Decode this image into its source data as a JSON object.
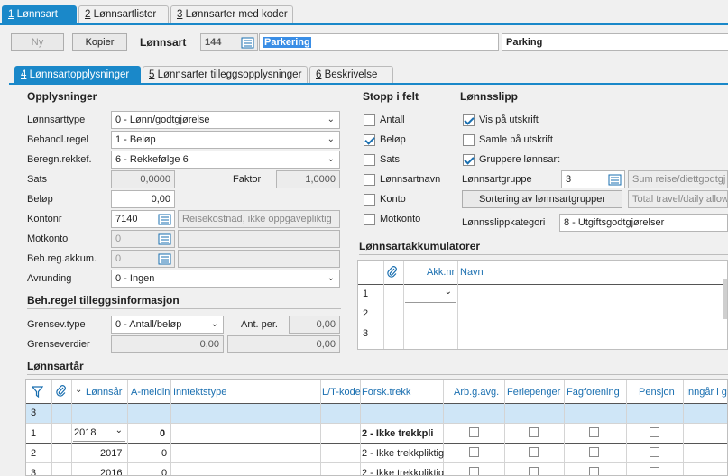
{
  "top_tabs": [
    {
      "num": "1",
      "label": " Lønnsart"
    },
    {
      "num": "2",
      "label": " Lønnsartlister"
    },
    {
      "num": "3",
      "label": " Lønnsarter med koder"
    }
  ],
  "toolbar": {
    "new_label": "Ny",
    "copy_label": "Kopier",
    "field_label": "Lønnsart",
    "code": "144",
    "name_value": "Parkering",
    "name2_value": "Parking"
  },
  "sub_tabs": [
    {
      "num": "4",
      "label": " Lønnsartopplysninger"
    },
    {
      "num": "5",
      "label": " Lønnsarter tilleggsopplysninger"
    },
    {
      "num": "6",
      "label": " Beskrivelse"
    }
  ],
  "opplysninger": {
    "title": "Opplysninger",
    "lonnsarttype_label": "Lønnsarttype",
    "lonnsarttype_value": "0 - Lønn/godtgjørelse",
    "behandl_label": "Behandl.regel",
    "behandl_value": "1 - Beløp",
    "beregn_label": "Beregn.rekkef.",
    "beregn_value": "6 - Rekkefølge 6",
    "sats_label": "Sats",
    "sats_value": "0,0000",
    "faktor_label": "Faktor",
    "faktor_value": "1,0000",
    "belop_label": "Beløp",
    "belop_value": "0,00",
    "kontonr_label": "Kontonr",
    "kontonr_value": "7140",
    "kontonr_desc": "Reisekostnad, ikke oppgavepliktig",
    "motkonto_label": "Motkonto",
    "motkonto_value": "0",
    "behreg_label": "Beh.reg.akkum.",
    "behreg_value": "0",
    "avrunding_label": "Avrunding",
    "avrunding_value": "0 - Ingen"
  },
  "tillegg": {
    "title": "Beh.regel tilleggsinformasjon",
    "grensev_label": "Grensev.type",
    "grensev_value": "0 - Antall/beløp",
    "antper_label": "Ant. per.",
    "antper_value": "0,00",
    "grenseverdier_label": "Grenseverdier",
    "grense1": "0,00",
    "grense2": "0,00"
  },
  "stopp": {
    "title": "Stopp i felt",
    "items": [
      {
        "label": "Antall",
        "checked": false
      },
      {
        "label": "Beløp",
        "checked": true
      },
      {
        "label": "Sats",
        "checked": false
      },
      {
        "label": "Lønnsartnavn",
        "checked": false
      },
      {
        "label": "Konto",
        "checked": false
      },
      {
        "label": "Motkonto",
        "checked": false
      }
    ]
  },
  "lonnsslipp": {
    "title": "Lønnsslipp",
    "vis_label": "Vis på utskrift",
    "samle_label": "Samle på utskrift",
    "grupp_label": "Gruppere lønnsart",
    "gruppe_label": "Lønnsartgruppe",
    "gruppe_value": "3",
    "gruppe_desc": "Sum reise/diettgodtgj",
    "sort_button": "Sortering av lønnsartgrupper",
    "sort_desc": "Total travel/daily allow",
    "kategori_label": "Lønnsslippkategori",
    "kategori_value": "8 - Utgiftsgodtgjørelser"
  },
  "akkumulatorer": {
    "title": "Lønnsartakkumulatorer",
    "col_akk": "Akk.nr",
    "col_navn": "Navn",
    "rows": [
      "1",
      "2",
      "3"
    ]
  },
  "lonnsarar": {
    "title": "Lønnsartår",
    "columns": [
      "Lønnsår",
      "A-meldin",
      "Inntektstype",
      "L/T-kode",
      "Forsk.trekk",
      "Arb.g.avg.",
      "Feriepenger",
      "Fagforening",
      "Pensjon",
      "Inngår i gr"
    ],
    "filter_row": "3",
    "rows": [
      {
        "n": "1",
        "year": "2018",
        "ameld": "0",
        "forsk": "2 - Ikke trekkpli"
      },
      {
        "n": "2",
        "year": "2017",
        "ameld": "0",
        "forsk": "2 - Ikke trekkpliktig"
      },
      {
        "n": "3",
        "year": "2016",
        "ameld": "0",
        "forsk": "2 - Ikke trekkpliktig"
      }
    ]
  }
}
